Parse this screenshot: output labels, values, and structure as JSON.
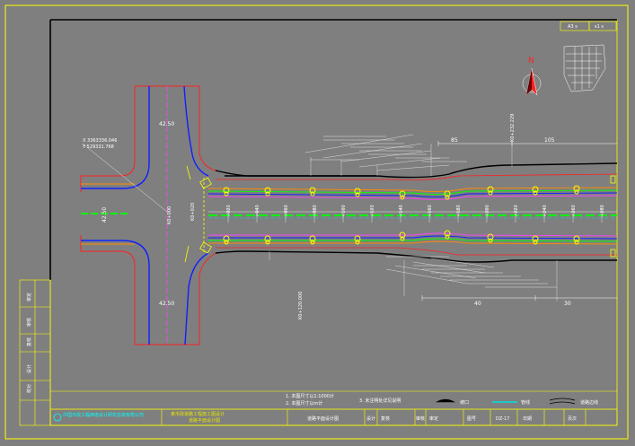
{
  "sheet": {
    "scale_box": "A3 s",
    "sheet_box": "s1 s",
    "north_label": "N",
    "drawing_no": "DZ-17"
  },
  "stations": [
    "+020",
    "+040",
    "+060",
    "+080",
    "+100",
    "+120",
    "+140",
    "+160",
    "+180",
    "+200",
    "+220",
    "+240",
    "+260",
    "+280"
  ],
  "dimensions": {
    "top_road_width": "42.50",
    "bottom_road_width": "42.50",
    "cross_width": "42.50",
    "offset_85": "85",
    "offset_105": "105",
    "offset_40": "40",
    "offset_30": "30"
  },
  "side_text_left": "K0+000",
  "side_text_right": "K0+020",
  "vertical_text_top": "K0+232.229",
  "vertical_text_bottom": "K0+120.000",
  "coord_label_1": "X 3363336.046",
  "coord_label_2": "Y 529331.768",
  "notes": {
    "note_1": "1. 本图尺寸以1:1000计",
    "note_2": "2. 本图尺寸以m计",
    "note_3": "3. 未注明处详见说明"
  },
  "legend": {
    "item_1": "坡口",
    "item_2": "管线",
    "item_3": "道路边线"
  },
  "title_block": {
    "company": "中国市政工程西南设计研究总院有限公司",
    "project_line1": "某市政道路工程施工图设计",
    "project_line2": "道路平面设计图",
    "drawing_title": "道路平面设计图",
    "design_label": "设计",
    "check_label": "复核",
    "review_label": "审核",
    "approve_label": "审定",
    "drawing_no_label": "图号",
    "date_label": "日期",
    "page_label": "页次"
  },
  "left_strip": {
    "row_1": "审定",
    "row_2": "审核",
    "row_3": "复核",
    "row_4": "设计",
    "row_5": "校对"
  },
  "colors": {
    "background": "#7f7f7f",
    "frame": "#ffff00",
    "road_edge": "#000000",
    "red_line": "#ff2020",
    "blue_line": "#1020ff",
    "green_line": "#00ff00",
    "magenta_line": "#ff40ff",
    "orange_line": "#ff8c00",
    "cyan_line": "#00e0e0"
  }
}
